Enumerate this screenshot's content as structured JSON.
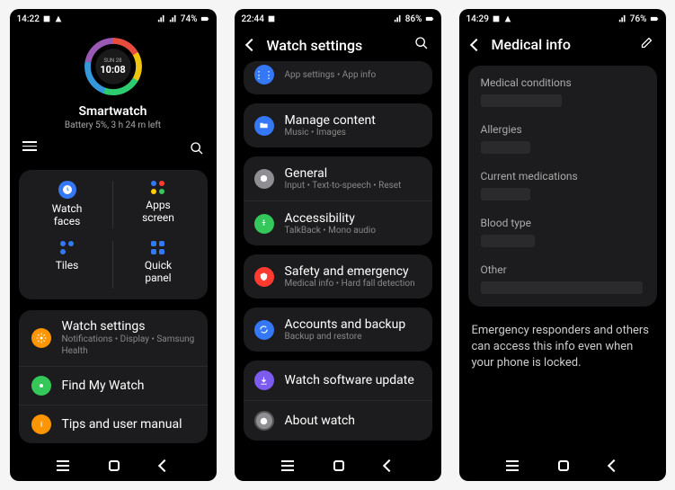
{
  "screen1": {
    "status": {
      "time": "14:22",
      "battery": "74%"
    },
    "watch_day": "SUN 28",
    "watch_time": "10:08",
    "watch_name": "Smartwatch",
    "watch_battery": "Battery 5%, 3 h 24 m left",
    "quad": [
      {
        "label": "Watch\nfaces"
      },
      {
        "label": "Apps\nscreen"
      },
      {
        "label": "Tiles"
      },
      {
        "label": "Quick\npanel"
      }
    ],
    "rows": [
      {
        "title": "Watch settings",
        "sub": "Notifications • Display • Samsung Health",
        "color": "#ff9500"
      },
      {
        "title": "Find My Watch",
        "sub": "",
        "color": "#34c759"
      },
      {
        "title": "Tips and user manual",
        "sub": "",
        "color": "#ff9500"
      }
    ]
  },
  "screen2": {
    "status": {
      "time": "22:44",
      "battery": "86%"
    },
    "title": "Watch settings",
    "partial_sub": "App settings • App info",
    "groups": [
      [
        {
          "title": "Manage content",
          "sub": "Music • Images",
          "color": "#3478f6"
        }
      ],
      [
        {
          "title": "General",
          "sub": "Input • Text-to-speech • Reset",
          "color": "#8e8e93"
        },
        {
          "title": "Accessibility",
          "sub": "TalkBack • Mono audio",
          "color": "#34c759"
        }
      ],
      [
        {
          "title": "Safety and emergency",
          "sub": "Medical info • Hard fall detection",
          "color": "#ff3b30"
        }
      ],
      [
        {
          "title": "Accounts and backup",
          "sub": "Backup and restore",
          "color": "#3478f6"
        }
      ],
      [
        {
          "title": "Watch software update",
          "sub": "",
          "color": "#7e5bef"
        },
        {
          "title": "About watch",
          "sub": "",
          "color": "#8e8e93"
        }
      ]
    ]
  },
  "screen3": {
    "status": {
      "time": "14:29",
      "battery": "76%"
    },
    "title": "Medical info",
    "fields": [
      "Medical conditions",
      "Allergies",
      "Current medications",
      "Blood type",
      "Other"
    ],
    "note": "Emergency responders and others can access this info even when your phone is locked."
  }
}
